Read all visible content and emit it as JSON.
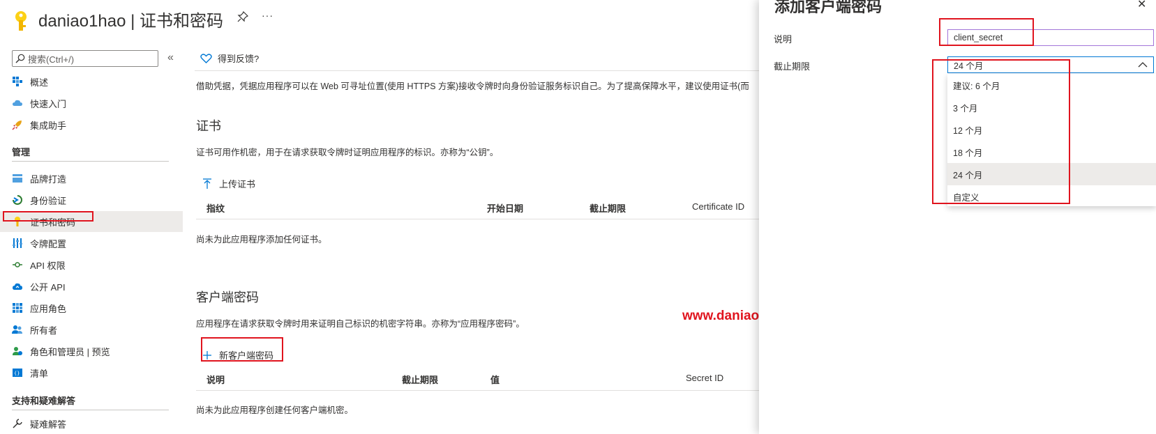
{
  "header": {
    "title": "daniao1hao | 证书和密码",
    "more_label": "···"
  },
  "sidebar": {
    "search_placeholder": "搜索(Ctrl+/)",
    "collapse_label": "«",
    "items_top": [
      {
        "label": "概述",
        "icon": "overview-icon"
      },
      {
        "label": "快速入门",
        "icon": "quickstart-cloud-icon"
      },
      {
        "label": "集成助手",
        "icon": "rocket-icon"
      }
    ],
    "section_manage": "管理",
    "items_manage": [
      {
        "label": "品牌打造",
        "icon": "branding-icon"
      },
      {
        "label": "身份验证",
        "icon": "authentication-icon"
      },
      {
        "label": "证书和密码",
        "icon": "key-icon",
        "active": true
      },
      {
        "label": "令牌配置",
        "icon": "token-config-icon"
      },
      {
        "label": "API 权限",
        "icon": "api-permissions-icon"
      },
      {
        "label": "公开 API",
        "icon": "expose-api-cloud-icon"
      },
      {
        "label": "应用角色",
        "icon": "app-roles-icon"
      },
      {
        "label": "所有者",
        "icon": "owners-icon"
      },
      {
        "label": "角色和管理员 | 预览",
        "icon": "roles-admins-icon"
      },
      {
        "label": "清单",
        "icon": "manifest-icon"
      }
    ],
    "section_support": "支持和疑难解答",
    "items_support": [
      {
        "label": "疑难解答",
        "icon": "wrench-icon"
      }
    ]
  },
  "main": {
    "feedback_label": "得到反馈?",
    "intro_text": "借助凭据，凭据应用程序可以在 Web 可寻址位置(使用 HTTPS 方案)接收令牌时向身份验证服务标识自己。为了提高保障水平，建议使用证书(而",
    "certificates": {
      "title": "证书",
      "description": "证书可用作机密，用于在请求获取令牌时证明应用程序的标识。亦称为“公钥”。",
      "upload_label": "上传证书",
      "columns": [
        "指纹",
        "开始日期",
        "截止期限",
        "Certificate ID"
      ],
      "empty_text": "尚未为此应用程序添加任何证书。"
    },
    "client_secrets": {
      "title": "客户端密码",
      "description": "应用程序在请求获取令牌时用来证明自己标识的机密字符串。亦称为“应用程序密码”。",
      "new_label": "新客户端密码",
      "columns": [
        "说明",
        "截止期限",
        "值",
        "Secret ID"
      ],
      "empty_text": "尚未为此应用程序创建任何客户端机密。"
    },
    "watermark": "www.daniao.org"
  },
  "panel": {
    "title": "添加客户端密码",
    "close_label": "✕",
    "description_label": "说明",
    "description_value": "client_secret",
    "expiry_label": "截止期限",
    "expiry_selected": "24 个月",
    "expiry_options": [
      "建议: 6 个月",
      "3 个月",
      "12 个月",
      "18 个月",
      "24 个月",
      "自定义"
    ]
  },
  "colors": {
    "accent": "#0078d4",
    "annotation_red": "#e0141e",
    "key_yellow": "#f7c600"
  }
}
